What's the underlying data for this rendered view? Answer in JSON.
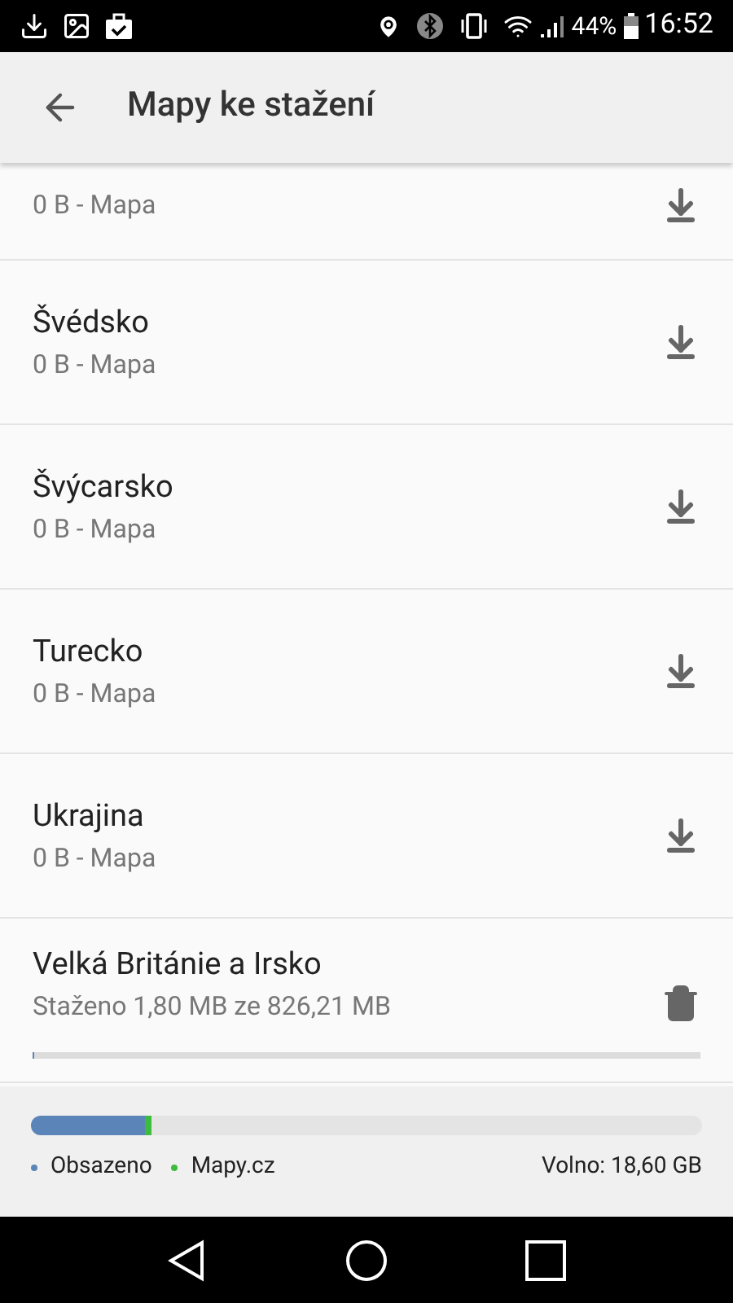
{
  "status_bar": {
    "battery": "44%",
    "time": "16:52"
  },
  "app_bar": {
    "title": "Mapy ke stažení"
  },
  "maps": [
    {
      "kind": "download",
      "subtitle": "0 B - Mapa",
      "partial": true
    },
    {
      "kind": "download",
      "name": "Švédsko",
      "subtitle": "0 B - Mapa"
    },
    {
      "kind": "download",
      "name": "Švýcarsko",
      "subtitle": "0 B - Mapa"
    },
    {
      "kind": "download",
      "name": "Turecko",
      "subtitle": "0 B - Mapa"
    },
    {
      "kind": "download",
      "name": "Ukrajina",
      "subtitle": "0 B - Mapa"
    },
    {
      "kind": "downloading",
      "name": "Velká Británie a Irsko",
      "subtitle": "Staženo 1,80 MB ze 826,21 MB",
      "level": 0.002
    }
  ],
  "storage": {
    "bar": [
      {
        "color": "#5b84b8",
        "level": 0.17
      },
      {
        "color": "#3dbb3d",
        "level": 0.01
      }
    ],
    "legend": [
      {
        "label": "Obsazeno",
        "color": "#5b84b8"
      },
      {
        "label": "Mapy.cz",
        "color": "#3dbb3d"
      }
    ],
    "free": "Volno: 18,60 GB"
  }
}
